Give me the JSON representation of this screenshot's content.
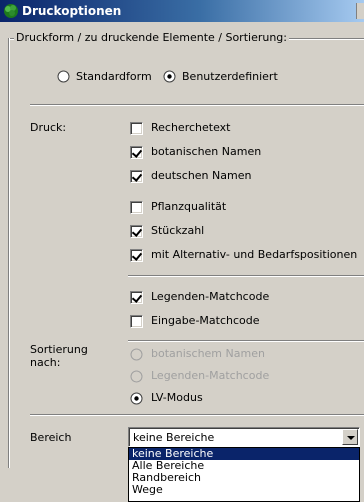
{
  "window": {
    "title": "Druckoptionen"
  },
  "druckform_group": {
    "label": "Druckform / zu druckende Elemente / Sortierung:",
    "options": [
      {
        "label": "Standardform",
        "selected": false
      },
      {
        "label": "Benutzerdefiniert",
        "selected": true
      }
    ]
  },
  "druck": {
    "label": "Druck:",
    "items": [
      {
        "label": "Recherchetext",
        "checked": false
      },
      {
        "label": "botanischen Namen",
        "checked": true
      },
      {
        "label": "deutschen Namen",
        "checked": true
      },
      {
        "label": "Pflanzqualität",
        "checked": false
      },
      {
        "label": "Stückzahl",
        "checked": true
      },
      {
        "label": "mit Alternativ- und Bedarfspositionen",
        "checked": true
      }
    ],
    "legend_items": [
      {
        "label": "Legenden-Matchcode",
        "checked": true
      },
      {
        "label": "Eingabe-Matchcode",
        "checked": false
      }
    ]
  },
  "sortierung": {
    "label_line1": "Sortierung",
    "label_line2": "nach:",
    "options": [
      {
        "label": "botanischem Namen",
        "selected": false,
        "disabled": true
      },
      {
        "label": "Legenden-Matchcode",
        "selected": false,
        "disabled": true
      },
      {
        "label": "LV-Modus",
        "selected": true,
        "disabled": false
      }
    ]
  },
  "bereich": {
    "label": "Bereich",
    "value": "keine Bereiche",
    "options": [
      "keine Bereiche",
      "Alle Bereiche",
      "Randbereich",
      "Wege"
    ]
  }
}
